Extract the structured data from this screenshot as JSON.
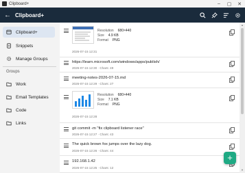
{
  "window": {
    "title": "Clipboard+"
  },
  "appbar": {
    "title": "Clipboard+"
  },
  "sidebar": {
    "nav": [
      {
        "label": "Clipboard+"
      },
      {
        "label": "Snippets"
      },
      {
        "label": "Manage Groups"
      }
    ],
    "groups_header": "Groups",
    "groups": [
      {
        "label": "Work"
      },
      {
        "label": "Email Templates"
      },
      {
        "label": "Code"
      },
      {
        "label": "Links"
      }
    ]
  },
  "items": [
    {
      "type": "image",
      "resolution_label": "Resolution",
      "resolution": "680×440",
      "size_label": "Size",
      "size": "4.9 KB",
      "format_label": "Format",
      "format": "PNG",
      "meta": "2026-07-15 12:31"
    },
    {
      "type": "text",
      "text": "https://learn.microsoft.com/windows/apps/publish/",
      "meta": "2026-07-15 12:30 · Chars: 49"
    },
    {
      "type": "text",
      "text": "meeting-notes-2026-07-15.md",
      "meta": "2026-07-15 12:29 · Chars: 27"
    },
    {
      "type": "image",
      "resolution_label": "Resolution",
      "resolution": "680×440",
      "size_label": "Size",
      "size": "7.1 KB",
      "format_label": "Format",
      "format": "PNG",
      "meta": "2026-07-15 12:28"
    },
    {
      "type": "text",
      "text": "git commit -m \"fix clipboard listener race\"",
      "meta": "2026-07-15 12:27 · Chars: 43"
    },
    {
      "type": "text",
      "text": "The quick brown fox jumps over the lazy dog.",
      "meta": "2026-07-15 12:26 · Chars: 44"
    },
    {
      "type": "text",
      "text": "192.168.1.42",
      "meta": "2026-07-15 12:25 · Chars: 12"
    }
  ],
  "icons": {
    "search": "search-icon",
    "pin": "pin-icon",
    "sort": "sort-icon",
    "settings": "gear-icon",
    "add": "plus-icon"
  },
  "colors": {
    "appbar": "#1a2b3c",
    "accent": "#1faa84",
    "nav_active": "#dde6f2"
  }
}
